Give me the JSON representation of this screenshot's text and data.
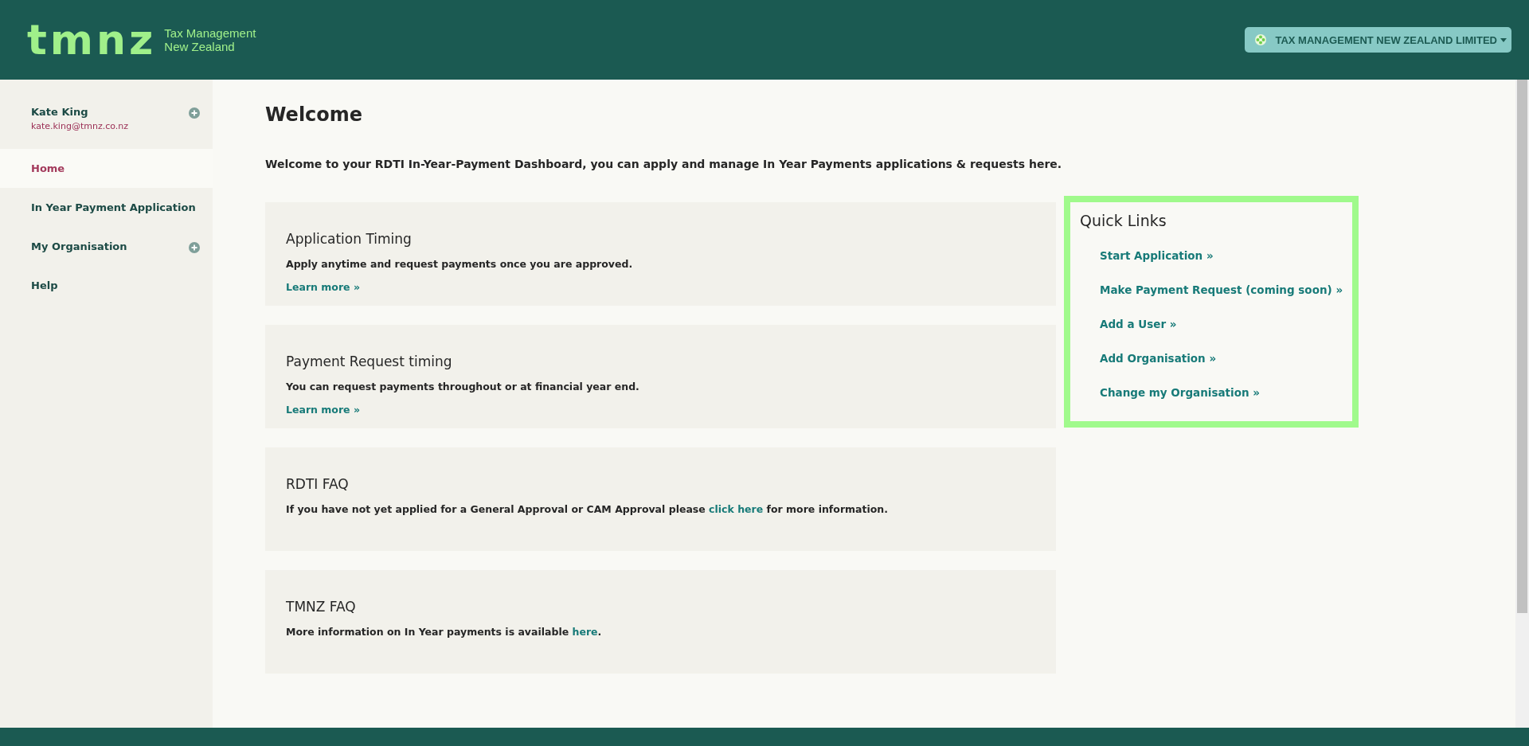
{
  "header": {
    "logo": "tmnz",
    "logo_subtitle": [
      "Tax Management",
      "New Zealand"
    ],
    "org_button": "TAX MANAGEMENT NEW ZEALAND LIMITED"
  },
  "sidebar": {
    "user": {
      "name": "Kate King",
      "email": "kate.king@tmnz.co.nz",
      "expandable": true
    },
    "items": [
      {
        "label": "Home",
        "selected": true,
        "expandable": false
      },
      {
        "label": "In Year Payment Application",
        "selected": false,
        "expandable": false
      },
      {
        "label": "My Organisation",
        "selected": false,
        "expandable": true
      },
      {
        "label": "Help",
        "selected": false,
        "expandable": false
      }
    ]
  },
  "main": {
    "title": "Welcome",
    "intro": "Welcome to your RDTI In-Year-Payment Dashboard, you can apply and manage In Year Payments applications & requests here.",
    "cards": [
      {
        "title": "Application Timing",
        "text_before": "Apply anytime and request payments once you are approved.",
        "more": "Learn more »"
      },
      {
        "title": "Payment Request timing",
        "text_before": "You can request payments throughout or at financial year end.",
        "more": "Learn more »"
      },
      {
        "title": "RDTI FAQ",
        "text_before": "If you have not yet applied for a General Approval or CAM Approval please ",
        "link": "click here",
        "text_after": " for more information."
      },
      {
        "title": "TMNZ FAQ",
        "text_before": "More information on In Year payments is available ",
        "link": "here",
        "text_after": "."
      }
    ]
  },
  "quick_links": {
    "title": "Quick Links",
    "links": [
      "Start Application »",
      "Make Payment Request (coming soon) »",
      "Add a User »",
      "Add Organisation »",
      "Change my Organisation »"
    ]
  }
}
